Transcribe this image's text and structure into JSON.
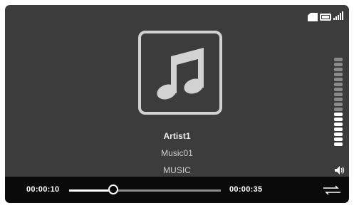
{
  "icons": {
    "status": [
      "sd-card-icon",
      "battery-icon",
      "signal-icon"
    ],
    "art": "music-note-icon",
    "volume": "speaker-icon",
    "menu": "repeat-menu-icon"
  },
  "track": {
    "artist": "Artist1",
    "title": "Music01",
    "album": "MUSIC"
  },
  "playback": {
    "elapsed": "00:00:10",
    "total": "00:00:35",
    "progress_fraction": 0.29
  },
  "volume": {
    "segments_total": 18,
    "segments_on": 7
  },
  "colors": {
    "background": "#3c3c3c",
    "bar": "#0a0a0a",
    "accent": "#ffffff"
  }
}
